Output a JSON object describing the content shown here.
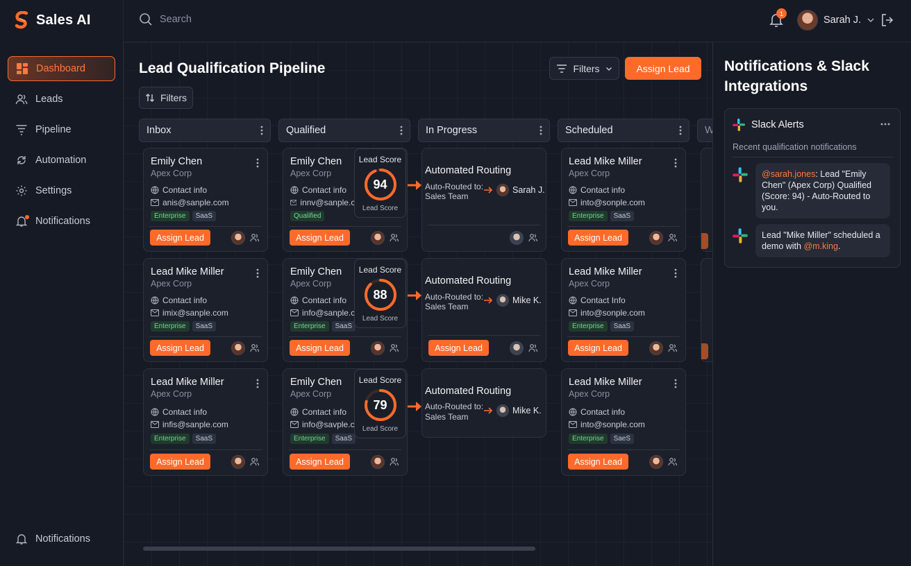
{
  "app": {
    "brand": "Sales AI"
  },
  "sidebar": {
    "items": [
      {
        "label": "Dashboard",
        "icon": "dashboard-icon",
        "active": true
      },
      {
        "label": "Leads",
        "icon": "users-icon"
      },
      {
        "label": "Pipeline",
        "icon": "funnel-icon"
      },
      {
        "label": "Automation",
        "icon": "automation-icon"
      },
      {
        "label": "Settings",
        "icon": "gear-icon"
      },
      {
        "label": "Notifications",
        "icon": "bell-icon"
      }
    ],
    "bottom": {
      "label": "Notifications",
      "icon": "bell-icon"
    }
  },
  "topbar": {
    "search_placeholder": "Search",
    "notification_count": "1",
    "user_name": "Sarah J."
  },
  "board": {
    "title": "Lead Qualification Pipeline",
    "filters_label": "Filters",
    "assign_label": "Assign Lead",
    "columns": [
      "Inbox",
      "Qualified",
      "In Progress",
      "Scheduled",
      "W"
    ],
    "score_label": "Lead Score",
    "contact_label": "Contact info",
    "tag_enterprise": "Enterprise",
    "tag_saas": "SaaS",
    "tag_qualified": "Qualified",
    "inbox": [
      {
        "name": "Emily Chen",
        "company": "Apex Corp",
        "email": "anis@sanple.com"
      },
      {
        "name": "Lead Mike Miller",
        "company": "Apex Corp",
        "email": "imix@sanple.com"
      },
      {
        "name": "Lead Mike Miller",
        "company": "Apex Corp",
        "email": "infis@sanple.com"
      }
    ],
    "qualified": [
      {
        "name": "Emily Chen",
        "company": "Apex Corp",
        "email": "innv@sanple.co",
        "score": "94",
        "tag": "Qualified"
      },
      {
        "name": "Emily Chen",
        "company": "Apex Corp",
        "email": "info@sanple.cc",
        "score": "88"
      },
      {
        "name": "Emily Chen",
        "company": "Apex Corp",
        "email": "info@savple.cc",
        "score": "79"
      }
    ],
    "routing": {
      "title": "Automated Routing",
      "line1": "Auto-Routed to:",
      "line2": "Sales Team",
      "targets": [
        "Sarah J.",
        "Mike K.",
        "Mike K."
      ]
    },
    "scheduled": [
      {
        "name": "Lead Mike Miller",
        "company": "Apex Corp",
        "contact": "Contact info",
        "email": "into@sonple.com"
      },
      {
        "name": "Lead Mike Miller",
        "company": "Apex Corp",
        "contact": "Contact Info",
        "email": "into@sonple.com"
      },
      {
        "name": "Lead Mike Miller",
        "company": "Apex Corp",
        "contact": "Contact info",
        "email": "into@sonple.com",
        "tag2": "SaeS"
      }
    ]
  },
  "panel": {
    "title": "Notifications & Slack Integrations",
    "slack_title": "Slack Alerts",
    "slack_sub": "Recent qualification notifications",
    "msg1_mention": "@sarah.jones",
    "msg1_text": ": Lead \"Emily Chen\" (Apex Corp) Qualified (Score: 94) - Auto-Routed to you.",
    "msg2_text": "Lead \"Mike Miller\" scheduled a demo with ",
    "msg2_mention": "@m.king",
    "msg2_end": "."
  },
  "colors": {
    "accent": "#ff6a2b",
    "background": "#141823",
    "card": "#1c202b"
  }
}
